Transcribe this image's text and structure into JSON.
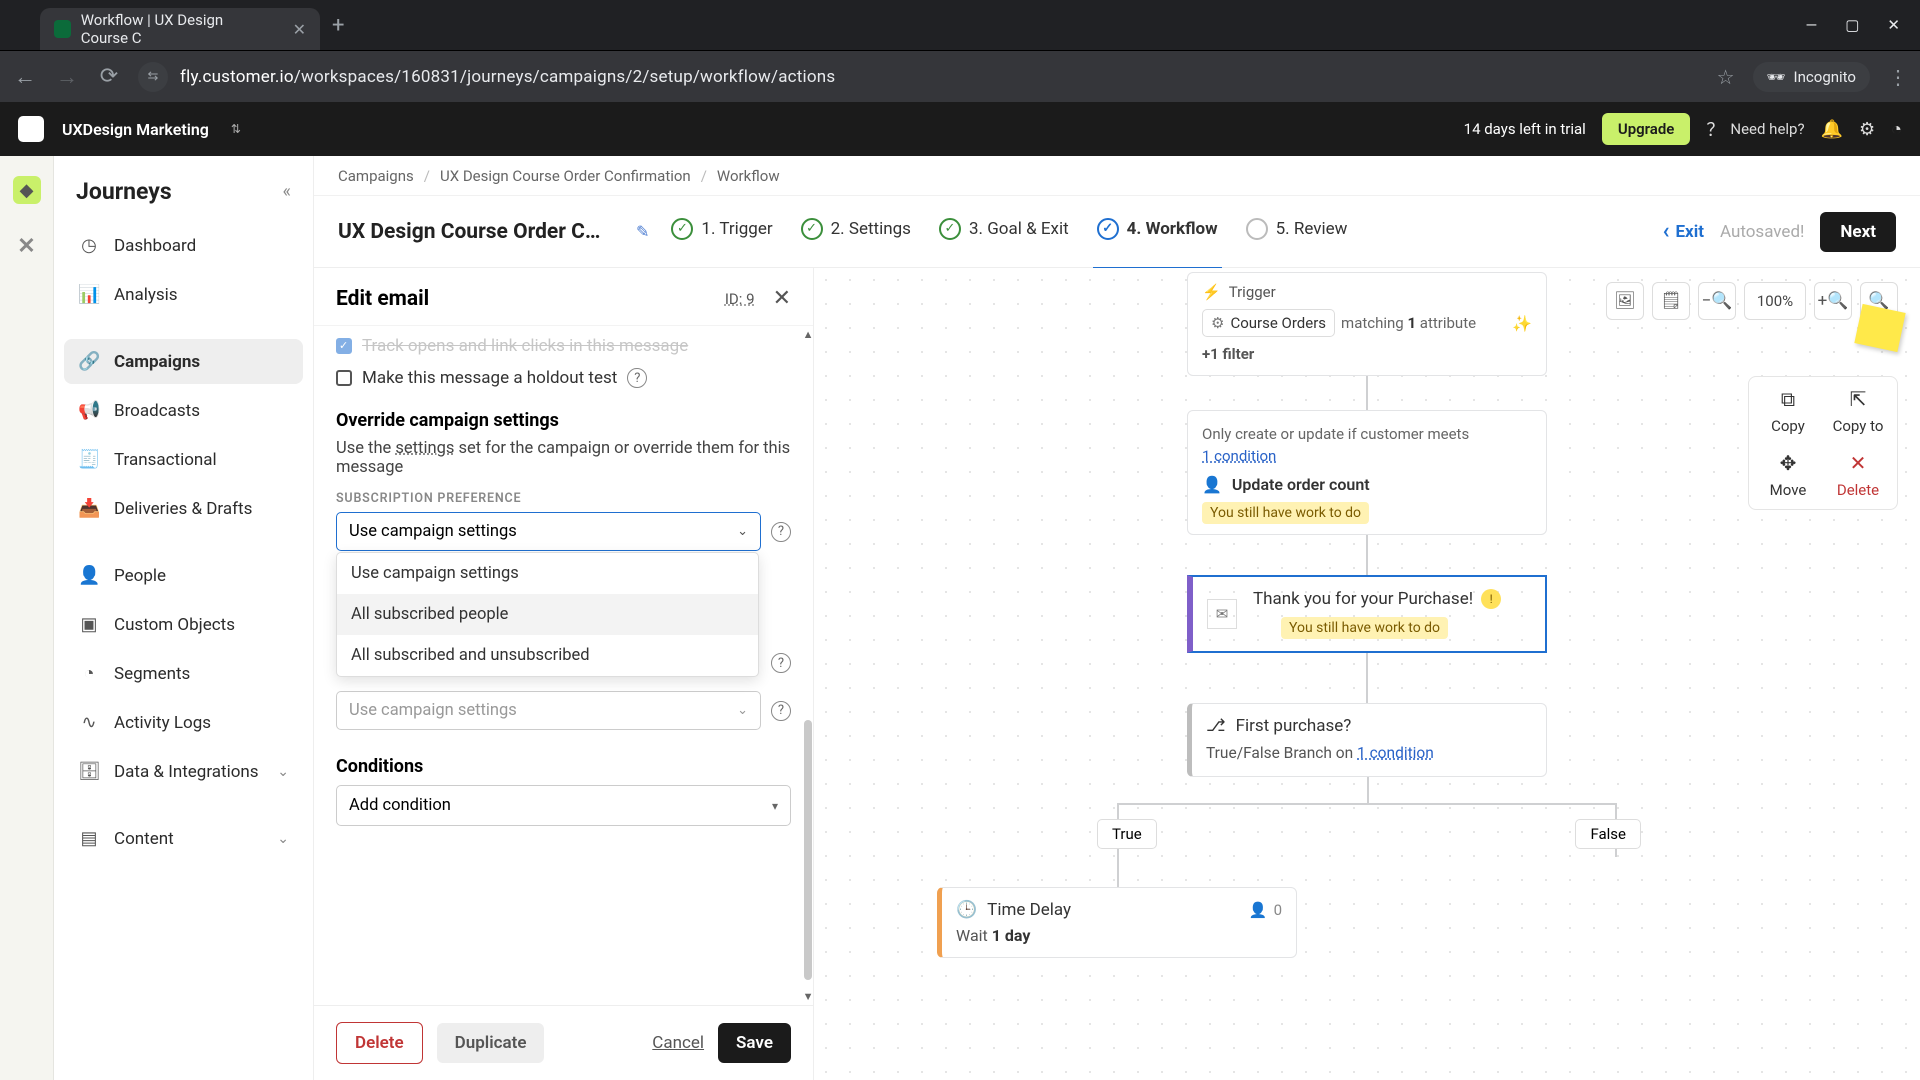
{
  "browser": {
    "tab_title": "Workflow | UX Design Course C",
    "url_host": "fly.customer.io",
    "url_path": "/workspaces/160831/journeys/campaigns/2/setup/workflow/actions",
    "incognito": "Incognito"
  },
  "header": {
    "workspace": "UXDesign Marketing",
    "trial": "14 days left in trial",
    "upgrade": "Upgrade",
    "help": "Need help?"
  },
  "sidebar": {
    "title": "Journeys",
    "items": [
      "Dashboard",
      "Analysis",
      "Campaigns",
      "Broadcasts",
      "Transactional",
      "Deliveries & Drafts",
      "People",
      "Custom Objects",
      "Segments",
      "Activity Logs",
      "Data & Integrations",
      "Content"
    ],
    "active_index": 2
  },
  "crumbs": [
    "Campaigns",
    "UX Design Course Order Confirmation",
    "Workflow"
  ],
  "stepbar": {
    "campaign_title": "UX Design Course Order Confir…",
    "steps": [
      "1. Trigger",
      "2. Settings",
      "3. Goal & Exit",
      "4. Workflow",
      "5. Review"
    ],
    "active_index": 3,
    "exit": "Exit",
    "autosaved": "Autosaved!",
    "next": "Next"
  },
  "panel": {
    "title": "Edit email",
    "id": "ID: 9",
    "track_line": "Track opens and link clicks in this message",
    "holdout": "Make this message a holdout test",
    "override_h": "Override campaign settings",
    "override_desc_pre": "Use the ",
    "override_desc_link": "settings",
    "override_desc_post": " set for the campaign or override them for this message",
    "field1_lab": "SUBSCRIPTION PREFERENCE",
    "select1": "Use campaign settings",
    "dd": [
      "Use campaign settings",
      "All subscribed people",
      "All subscribed and unsubscribed"
    ],
    "select2": "Use campaign settings",
    "cond_h": "Conditions",
    "cond_sel": "Add condition",
    "delete": "Delete",
    "duplicate": "Duplicate",
    "cancel": "Cancel",
    "save": "Save"
  },
  "canvas": {
    "zoom": "100%",
    "side_actions": [
      "Copy",
      "Copy to",
      "Move",
      "Delete"
    ],
    "trigger": {
      "label": "Trigger",
      "segment": "Course Orders",
      "attr_pre": "matching ",
      "attr_n": "1",
      "attr_post": " attribute",
      "filter": "+1 filter"
    },
    "cond": {
      "line1": "Only create or update if customer meets",
      "link": "1 condition",
      "line2": "Update order count",
      "warn": "You still have work to do"
    },
    "email": {
      "title": "Thank you for your Purchase!",
      "warn": "You still have work to do"
    },
    "branch": {
      "title": "First purchase?",
      "sub_pre": "True/False Branch on ",
      "sub_link": "1 condition",
      "true": "True",
      "false": "False"
    },
    "delay": {
      "title": "Time Delay",
      "people": "0",
      "wait_pre": "Wait ",
      "wait_b": "1 day"
    }
  }
}
